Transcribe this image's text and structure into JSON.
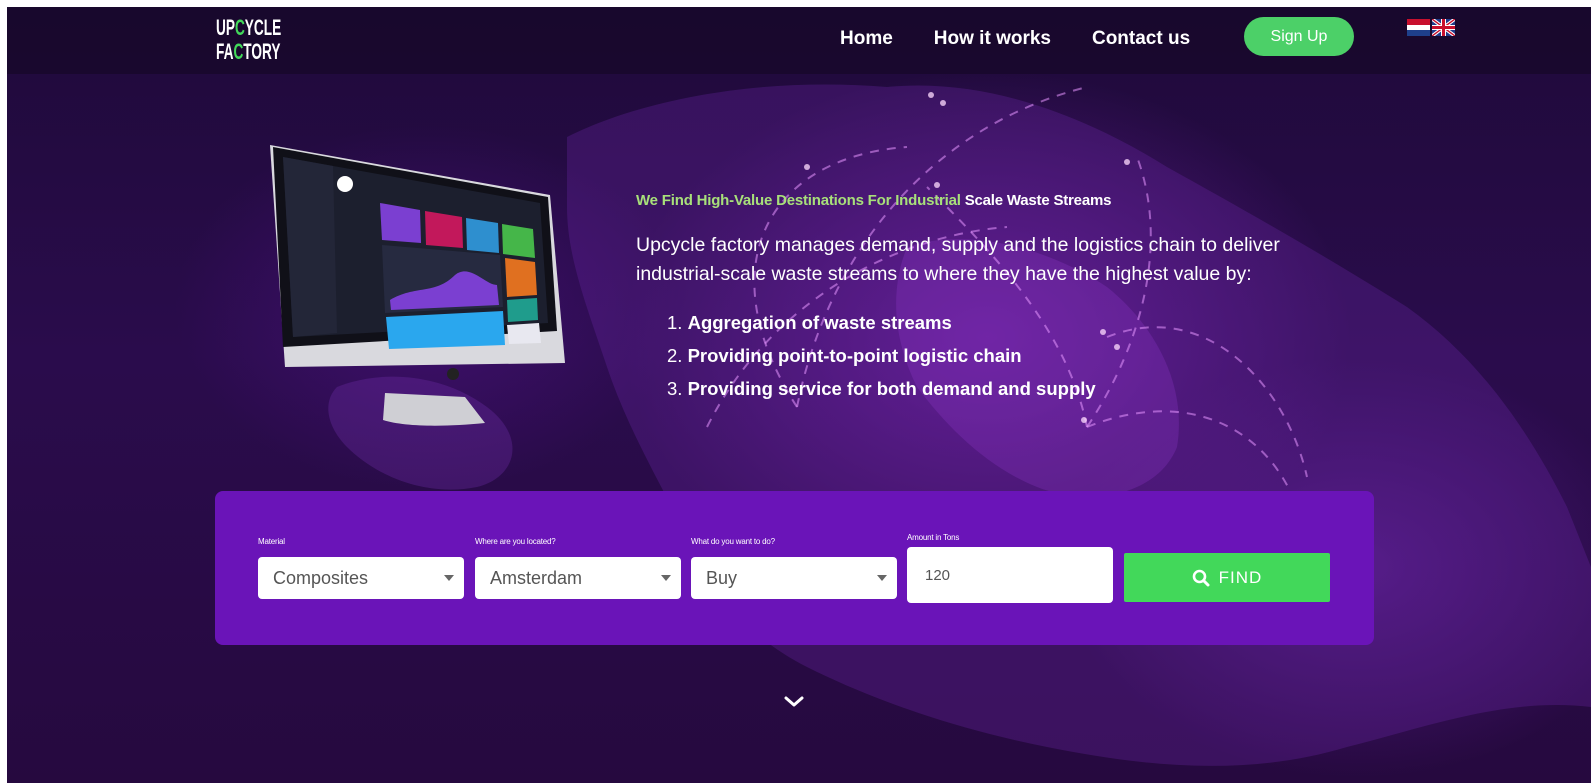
{
  "header": {
    "logo": {
      "line1_a": "UP",
      "line1_accent": "C",
      "line1_b": "YCLE",
      "line2_a": "FA",
      "line2_accent": "C",
      "line2_b": "TORY"
    },
    "nav": [
      {
        "label": "Home"
      },
      {
        "label": "How it works"
      },
      {
        "label": "Contact us"
      }
    ],
    "signup_label": "Sign Up",
    "flags": [
      "flag-nl-icon",
      "flag-uk-icon"
    ]
  },
  "hero": {
    "tagline_highlight": "We Find High-Value Destinations For Industrial ",
    "tagline_rest": "Scale Waste Streams",
    "description": "Upcycle factory manages demand, supply and the logistics chain to deliver industrial-scale waste streams to where they have the highest value by:",
    "benefits": [
      {
        "num": "1.",
        "text": "Aggregation of waste streams"
      },
      {
        "num": "2.",
        "text": "Providing point-to-point logistic chain"
      },
      {
        "num": "3.",
        "text": "Providing service for both demand and supply"
      }
    ]
  },
  "search": {
    "material": {
      "label": "Material",
      "value": "Composites"
    },
    "location": {
      "label": "Where are you located?",
      "value": "Amsterdam"
    },
    "action": {
      "label": "What do you want to do?",
      "value": "Buy"
    },
    "amount": {
      "label": "Amount in Tons",
      "value": "120"
    },
    "find_label": "FIND"
  },
  "colors": {
    "accent_green": "#42d85a",
    "panel_purple": "#6a14b8",
    "tagline_green": "#a8e07a"
  }
}
